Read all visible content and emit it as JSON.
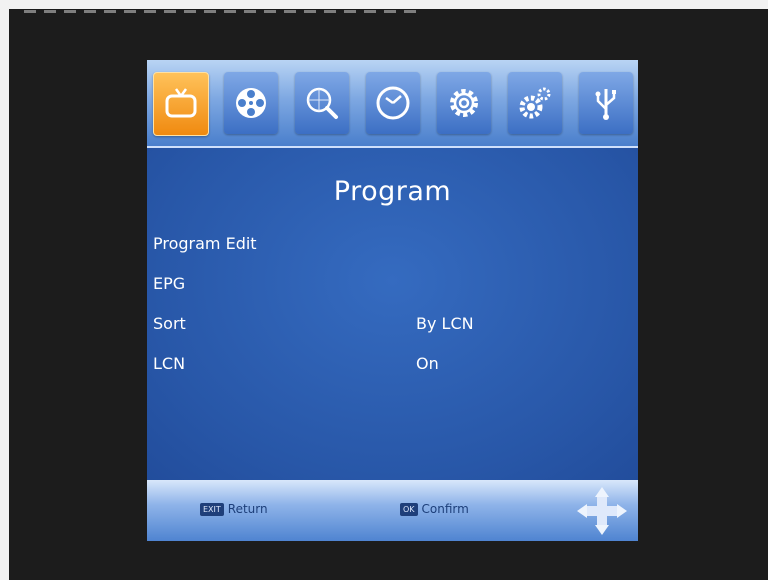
{
  "menu": {
    "tabs": [
      {
        "icon": "tv-icon",
        "active": true
      },
      {
        "icon": "film-reel-icon",
        "active": false
      },
      {
        "icon": "search-globe-icon",
        "active": false
      },
      {
        "icon": "clock-icon",
        "active": false
      },
      {
        "icon": "settings-gear-icon",
        "active": false
      },
      {
        "icon": "gears-icon",
        "active": false
      },
      {
        "icon": "usb-icon",
        "active": false
      }
    ],
    "title": "Program",
    "items": [
      {
        "label": "Program Edit",
        "value": ""
      },
      {
        "label": "EPG",
        "value": ""
      },
      {
        "label": "Sort",
        "value": "By LCN"
      },
      {
        "label": "LCN",
        "value": "On"
      }
    ],
    "footer": {
      "exit_key": "EXIT",
      "exit_label": "Return",
      "ok_key": "OK",
      "ok_label": "Confirm"
    }
  },
  "colors": {
    "panel": "#2b5fb3",
    "active_tab": "#f5a025",
    "background": "#1c1c1c"
  }
}
